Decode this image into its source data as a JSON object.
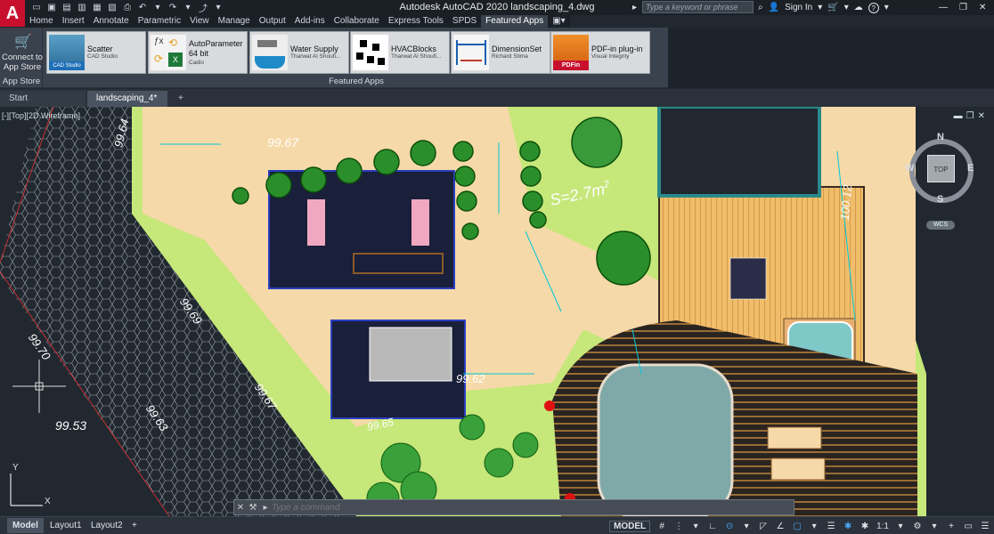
{
  "window": {
    "logo": "A",
    "title": "Autodesk AutoCAD 2020   landscaping_4.dwg",
    "search_placeholder": "Type a keyword or phrase",
    "sign_in": "Sign In",
    "help": "?"
  },
  "ribbon_tabs": [
    "Home",
    "Insert",
    "Annotate",
    "Parametric",
    "View",
    "Manage",
    "Output",
    "Add-ins",
    "Collaborate",
    "Express Tools",
    "SPDS",
    "Featured Apps"
  ],
  "ribbon_active_tab": "Featured Apps",
  "app_store": {
    "button_label": "Connect to App Store",
    "panel_label": "App Store"
  },
  "featured_panel_title": "Featured Apps",
  "apps": [
    {
      "name": "Scatter",
      "vendor": "CAD Studio",
      "badge": "CAD Studio"
    },
    {
      "name": "AutoParameter",
      "line2": "64 bit",
      "vendor": "Cadio"
    },
    {
      "name": "Water Supply",
      "vendor": "Tharwat Al Shoufi..."
    },
    {
      "name": "HVACBlocks",
      "vendor": "Tharwat Al Shoufi..."
    },
    {
      "name": "DimensionSet",
      "vendor": "Richard Stima"
    },
    {
      "name": "PDF-in plug-in",
      "vendor": "Visual Integrity",
      "badge": "PDFin"
    }
  ],
  "doc_tabs": [
    "Start",
    "landscaping_4*"
  ],
  "viewport": {
    "label": "[-][Top][2D Wireframe]"
  },
  "viewcube": {
    "top": "TOP",
    "north": "N",
    "south": "S",
    "east": "E",
    "west": "W",
    "wcs": "WCS"
  },
  "drawing": {
    "elevations": [
      "99.67",
      "99.64",
      "99.69",
      "99.70",
      "99.67",
      "99.63",
      "99.53",
      "99.62",
      "99.65",
      "100.12"
    ],
    "area_label": "S=2.7m",
    "area_superscript": "2"
  },
  "command": {
    "placeholder": "Type a command"
  },
  "layout_tabs": [
    "Model",
    "Layout1",
    "Layout2"
  ],
  "status": {
    "model_label": "MODEL",
    "scale": "1:1"
  },
  "colors": {
    "logo_red": "#c8102e",
    "ribbon": "#39424d",
    "canvas": "#212830",
    "lawn": "#c6e77a",
    "paving": "#f6d9a8"
  }
}
